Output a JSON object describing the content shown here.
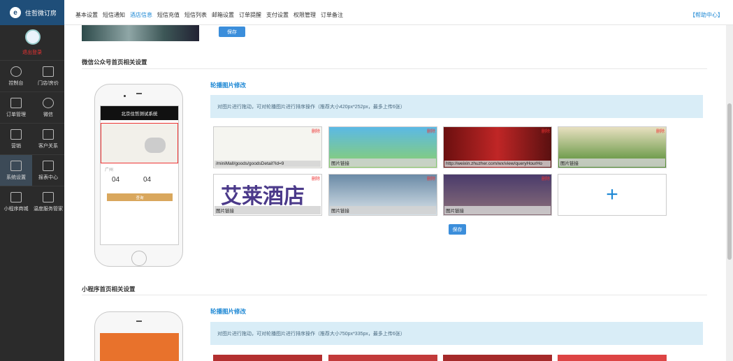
{
  "sidebar": {
    "brand": "住哲微订房",
    "logout": "退出登录",
    "items": [
      {
        "label": "控制台",
        "icon": "sun-icon"
      },
      {
        "label": "门店/房价",
        "icon": "building-icon"
      },
      {
        "label": "订单管理",
        "icon": "document-icon"
      },
      {
        "label": "微信",
        "icon": "wechat-icon"
      },
      {
        "label": "营销",
        "icon": "ticket-icon"
      },
      {
        "label": "客户关系",
        "icon": "handshake-icon"
      },
      {
        "label": "系统设置",
        "icon": "sliders-icon"
      },
      {
        "label": "报表中心",
        "icon": "chart-icon"
      },
      {
        "label": "小程序商城",
        "icon": "document-icon"
      },
      {
        "label": "温度服务管家",
        "icon": "handshake-icon"
      }
    ]
  },
  "nav": {
    "items": [
      "基本设置",
      "短信通知",
      "酒店信息",
      "短信充值",
      "短信列表",
      "邮箱设置",
      "订单提醒",
      "支付设置",
      "权限管理",
      "订单备注"
    ],
    "active": "酒店信息",
    "help": "【帮助中心】"
  },
  "save_label": "保存",
  "wechat": {
    "title": "微信公众号首页相关设置",
    "carousel_link": "轮播图片修改",
    "note": "对图片进行拖动，可对轮播图片进行排序操作（推荐大小420px*252px，最多上传6张）",
    "phone_header": "北京住哲测试系统",
    "phone_date_a": "04",
    "phone_date_b": "04",
    "phone_place": "广州",
    "phone_search": "查询",
    "tiles": [
      {
        "label": "/miniMall/goods/goodsDetail?id=9",
        "bg": "#f5f5f0"
      },
      {
        "label": "图片链接",
        "bg": "#5bb9e6"
      },
      {
        "label": "http://weixin.zhuzher.com/wx/view/queryHourHo",
        "bg": "#b32020"
      },
      {
        "label": "图片链接",
        "bg": "#6da444"
      },
      {
        "label": "图片链接",
        "bg": "#ffffff",
        "text": "艾莱酒店"
      },
      {
        "label": "图片链接",
        "bg": "#9fb8cc"
      },
      {
        "label": "图片链接",
        "bg": "#4a3b6b"
      }
    ],
    "delete_label": "删除"
  },
  "mini": {
    "title": "小程序首页相关设置",
    "carousel_link": "轮播图片修改",
    "note": "对图片进行拖动，可对轮播图片进行排序操作（推荐大小750px*335px，最多上传6张）"
  }
}
